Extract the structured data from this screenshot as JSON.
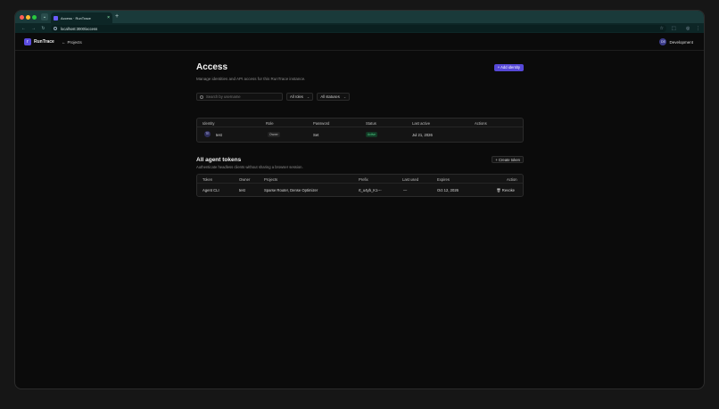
{
  "browser": {
    "tab_title": "Access · RunTrace",
    "tab_close": "×",
    "new_tab": "+",
    "menu_glyph": "⌄",
    "url": "localhost:3000/access",
    "nav": {
      "back": "←",
      "forward": "→",
      "reload": "↻"
    },
    "star_glyph": "☆",
    "ext_glyph": "⬚",
    "profile_glyph": "◎",
    "kebab_glyph": "⋮"
  },
  "app": {
    "brand_logo": "r",
    "brand": "RunTrace",
    "projects_arrow": "←",
    "projects_link": "Projects",
    "env_initials": "DE",
    "env_name": "Development"
  },
  "page": {
    "title": "Access",
    "subtitle": "Manage identities and API access for this RunTrace instance.",
    "add_button": "+ Add identity",
    "search_placeholder": "Search by username",
    "filter_roles": "All roles",
    "filter_statuses": "All statuses",
    "chevron": "⌄"
  },
  "identities": {
    "headers": [
      "Identity",
      "Role",
      "Password",
      "Status",
      "Last active",
      "Actions"
    ],
    "rows": [
      {
        "initials": "TE",
        "name": "test",
        "role": "Owner",
        "password": "Set",
        "status": "Active",
        "last_active": "Jul 21, 2026",
        "actions": ""
      }
    ]
  },
  "tokens": {
    "title": "All agent tokens",
    "subtitle": "Authenticate headless clients without sharing a browser session.",
    "create_button": "+ Create token",
    "headers": [
      "Token",
      "Owner",
      "Projects",
      "Prefix",
      "Last used",
      "Expires",
      "Action"
    ],
    "rows": [
      {
        "token": "Agent CLI",
        "owner": "test",
        "projects": "Sparse Router, Dense Optimizer",
        "prefix": "rt_u4yb_K1---",
        "last_used": "—",
        "expires": "Oct 12, 2026",
        "action": "🗑 Revoke"
      }
    ]
  }
}
